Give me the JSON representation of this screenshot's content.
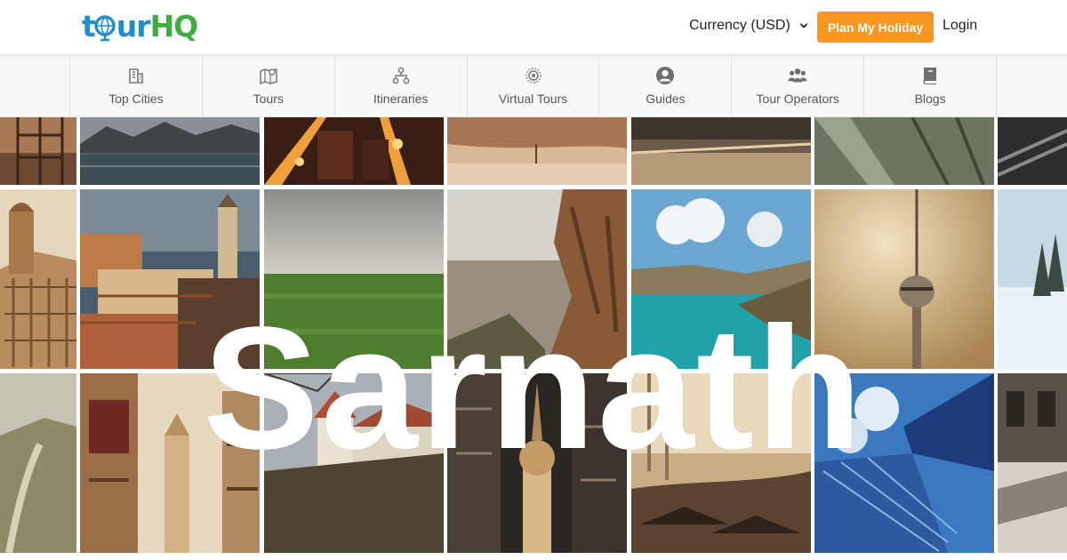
{
  "brand": {
    "logo_text_1": "to",
    "logo_text_2": "ur",
    "logo_text_3": "HQ",
    "logo_full": "tourHQ",
    "color_blue": "#1e8fc9",
    "color_green": "#3cae3f"
  },
  "header": {
    "currency_label": "Currency (USD)",
    "plan_button_label": "Plan My Holiday",
    "login_label": "Login",
    "accent_color": "#f7971e"
  },
  "nav": {
    "items": [
      {
        "label": "Top Cities",
        "icon": "building-icon"
      },
      {
        "label": "Tours",
        "icon": "map-pin-icon"
      },
      {
        "label": "Itineraries",
        "icon": "network-icon"
      },
      {
        "label": "Virtual Tours",
        "icon": "target-icon"
      },
      {
        "label": "Guides",
        "icon": "user-circle-icon"
      },
      {
        "label": "Tour Operators",
        "icon": "users-icon"
      },
      {
        "label": "Blogs",
        "icon": "book-icon"
      }
    ]
  },
  "hero": {
    "title": "Sarnath"
  },
  "collage": {
    "photos": [
      "scaffold-tower",
      "river-city",
      "city-night",
      "desert-sand",
      "old-square",
      "forest-path",
      "rail-track",
      "clock-tower",
      "hill-town",
      "green-field",
      "rock-cliff",
      "coast-bay",
      "tv-tower",
      "snow-trees",
      "mountain-road",
      "narrow-street",
      "castle-hill",
      "domed-church",
      "market-haze",
      "glass-tower",
      "stone-building"
    ]
  }
}
